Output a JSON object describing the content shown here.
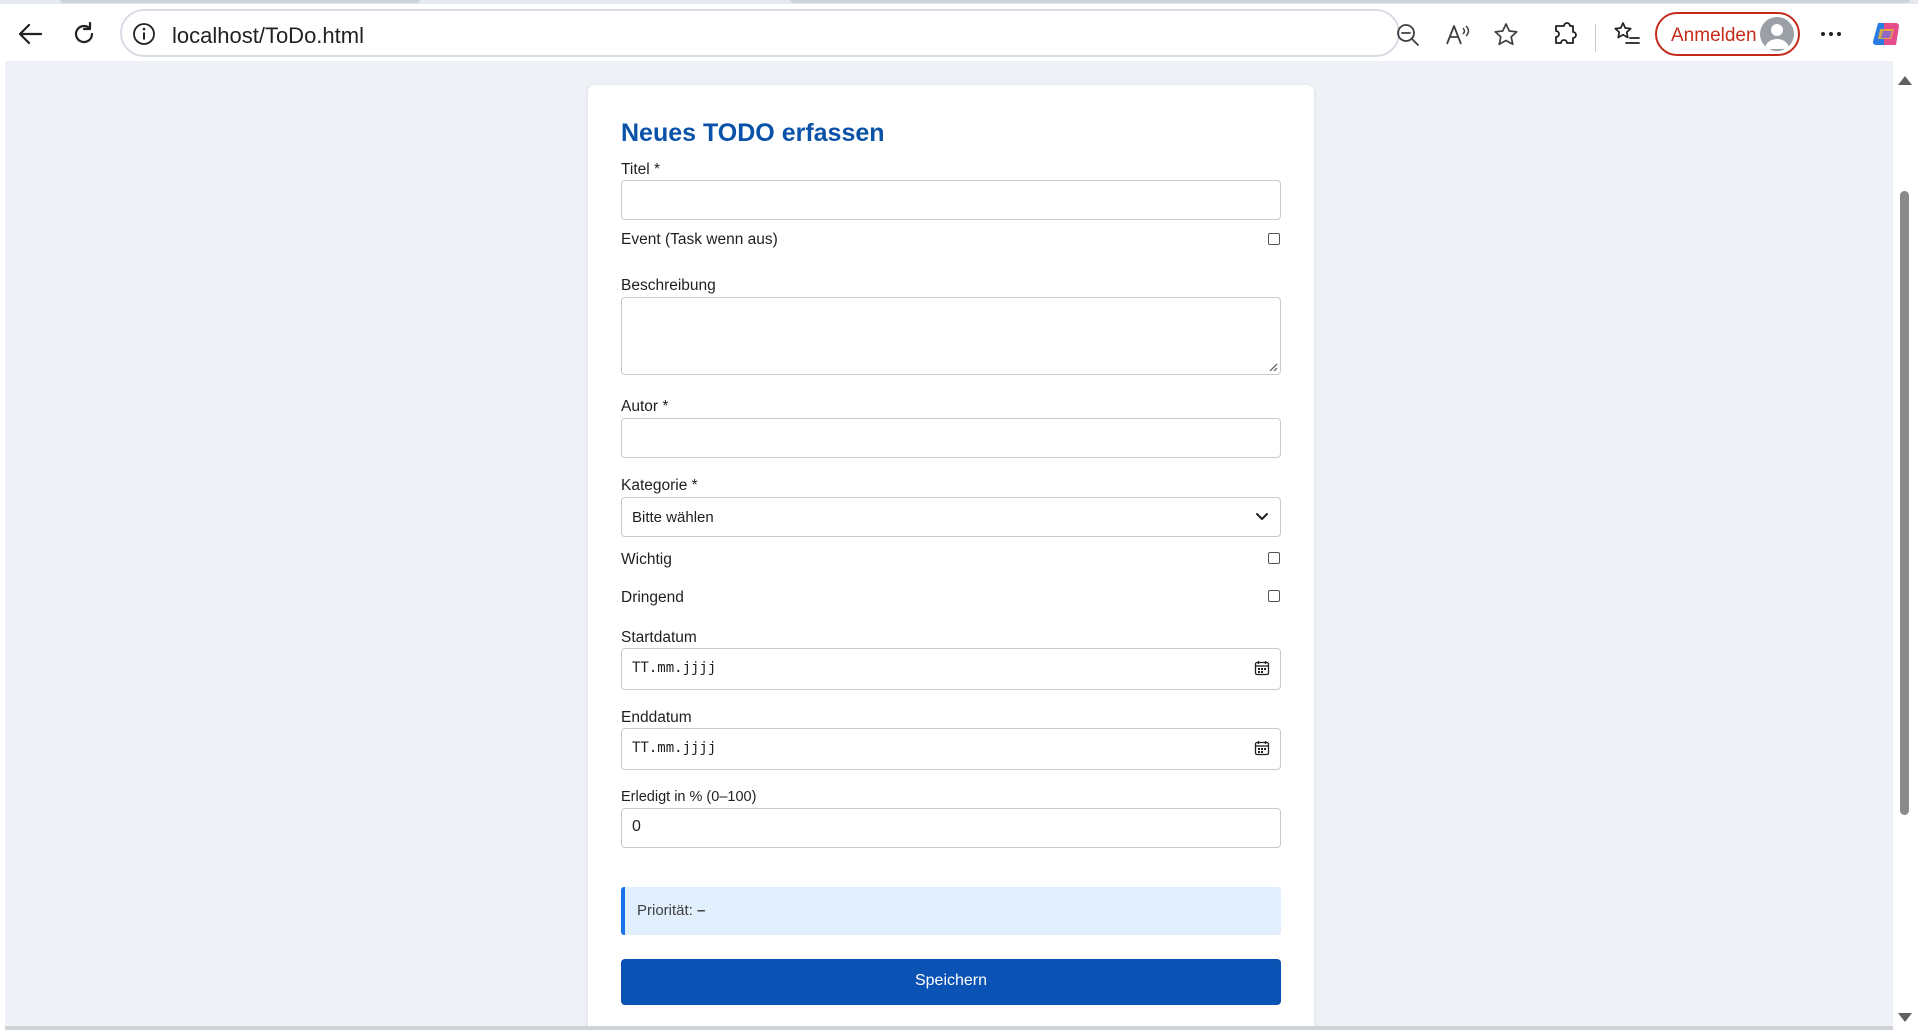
{
  "browser": {
    "url": "localhost/ToDo.html",
    "signin_label": "Anmelden"
  },
  "form": {
    "title": "Neues TODO erfassen",
    "fields": {
      "titel_label": "Titel *",
      "titel_value": "",
      "event_label": "Event (Task wenn aus)",
      "event_checked": false,
      "beschreibung_label": "Beschreibung",
      "beschreibung_value": "",
      "autor_label": "Autor *",
      "autor_value": "",
      "kategorie_label": "Kategorie *",
      "kategorie_selected": "Bitte wählen",
      "wichtig_label": "Wichtig",
      "wichtig_checked": false,
      "dringend_label": "Dringend",
      "dringend_checked": false,
      "startdatum_label": "Startdatum",
      "startdatum_placeholder": "TT.mm.jjjj",
      "enddatum_label": "Enddatum",
      "enddatum_placeholder": "TT.mm.jjjj",
      "erledigt_label": "Erledigt in % (0–100)",
      "erledigt_value": "0"
    },
    "priority": {
      "label": "Priorität:",
      "value": "–"
    },
    "save_label": "Speichern"
  },
  "colors": {
    "accent": "#0a52b3",
    "title": "#0a52a8",
    "page_bg": "#eef1f6",
    "priority_bg": "#e1eefb",
    "signin": "#c42b1c"
  }
}
